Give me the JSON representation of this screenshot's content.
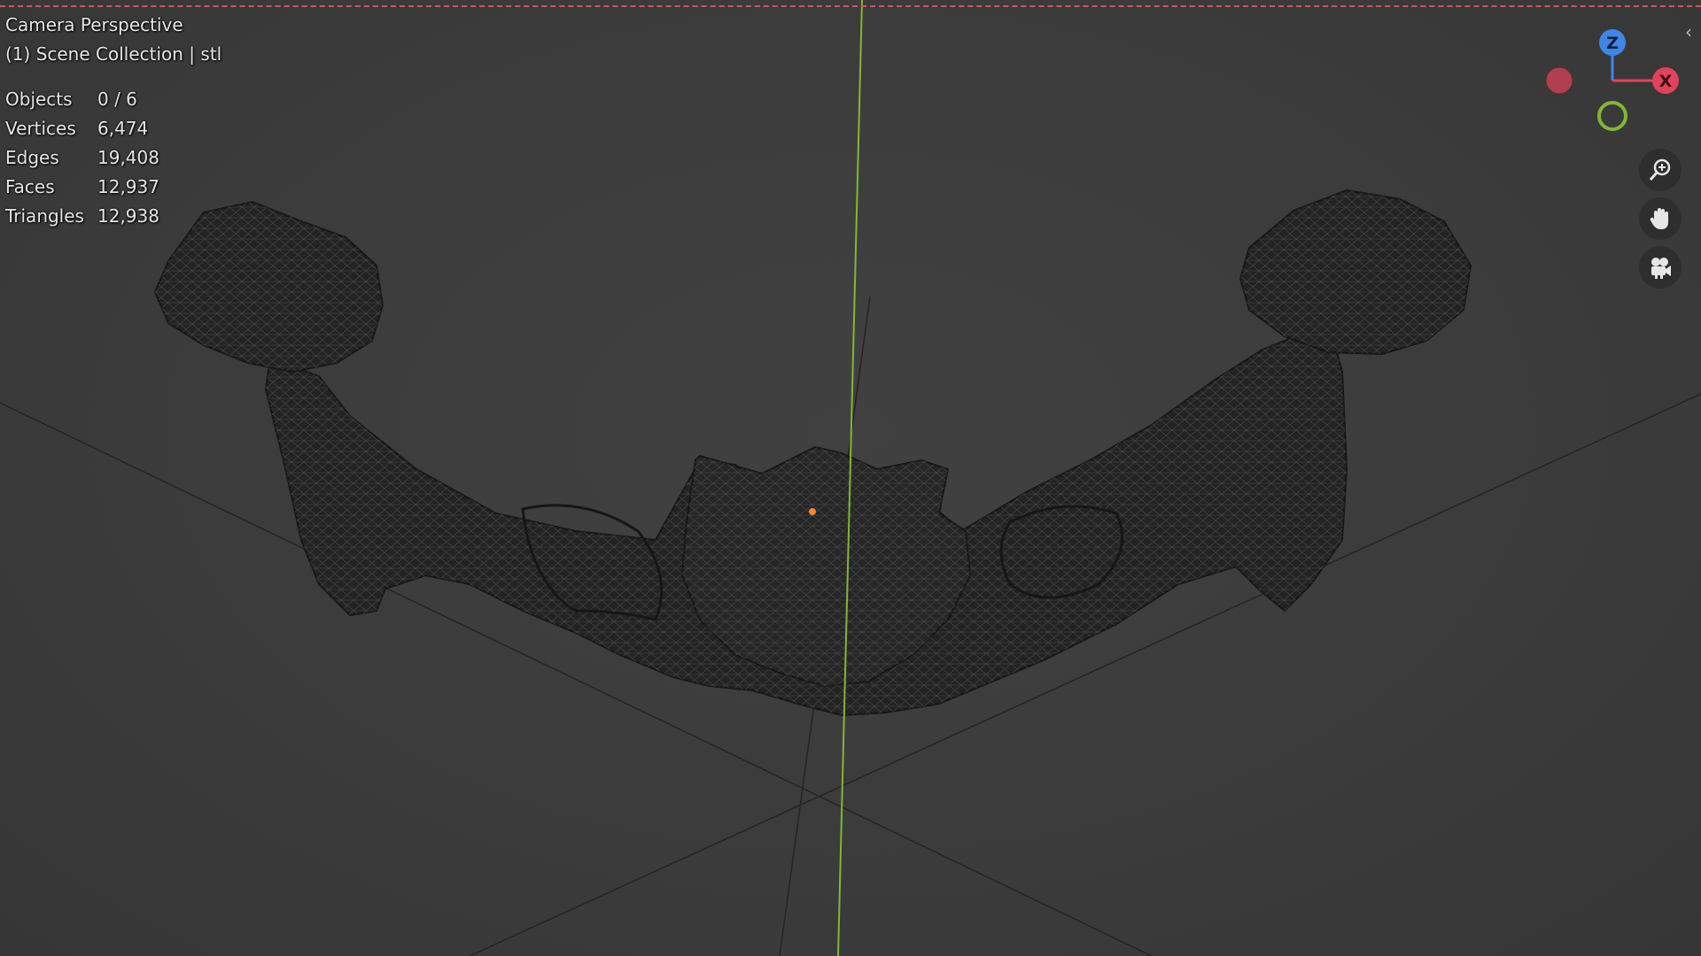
{
  "viewport": {
    "title": "Camera Perspective",
    "collection": "(1) Scene Collection | stl"
  },
  "stats": [
    {
      "label": "Objects",
      "value": "0 / 6"
    },
    {
      "label": "Vertices",
      "value": "6,474"
    },
    {
      "label": "Edges",
      "value": "19,408"
    },
    {
      "label": "Faces",
      "value": "12,937"
    },
    {
      "label": "Triangles",
      "value": "12,938"
    }
  ],
  "gizmo": {
    "z_label": "Z",
    "x_label": "X",
    "colors": {
      "x": "#e0435a",
      "y": "#84b536",
      "z": "#3f86e6",
      "neg_x": "#b04050"
    }
  },
  "icons": {
    "zoom": "zoom-in-icon",
    "pan": "hand-icon",
    "camera": "camera-icon",
    "collapse": "chevron-left-icon"
  },
  "colors": {
    "background": "#3d3d3d",
    "grid": "#242424",
    "y_axis": "#84b536",
    "origin": "#ff8a1f",
    "wireframe": "#1b1b1b"
  }
}
